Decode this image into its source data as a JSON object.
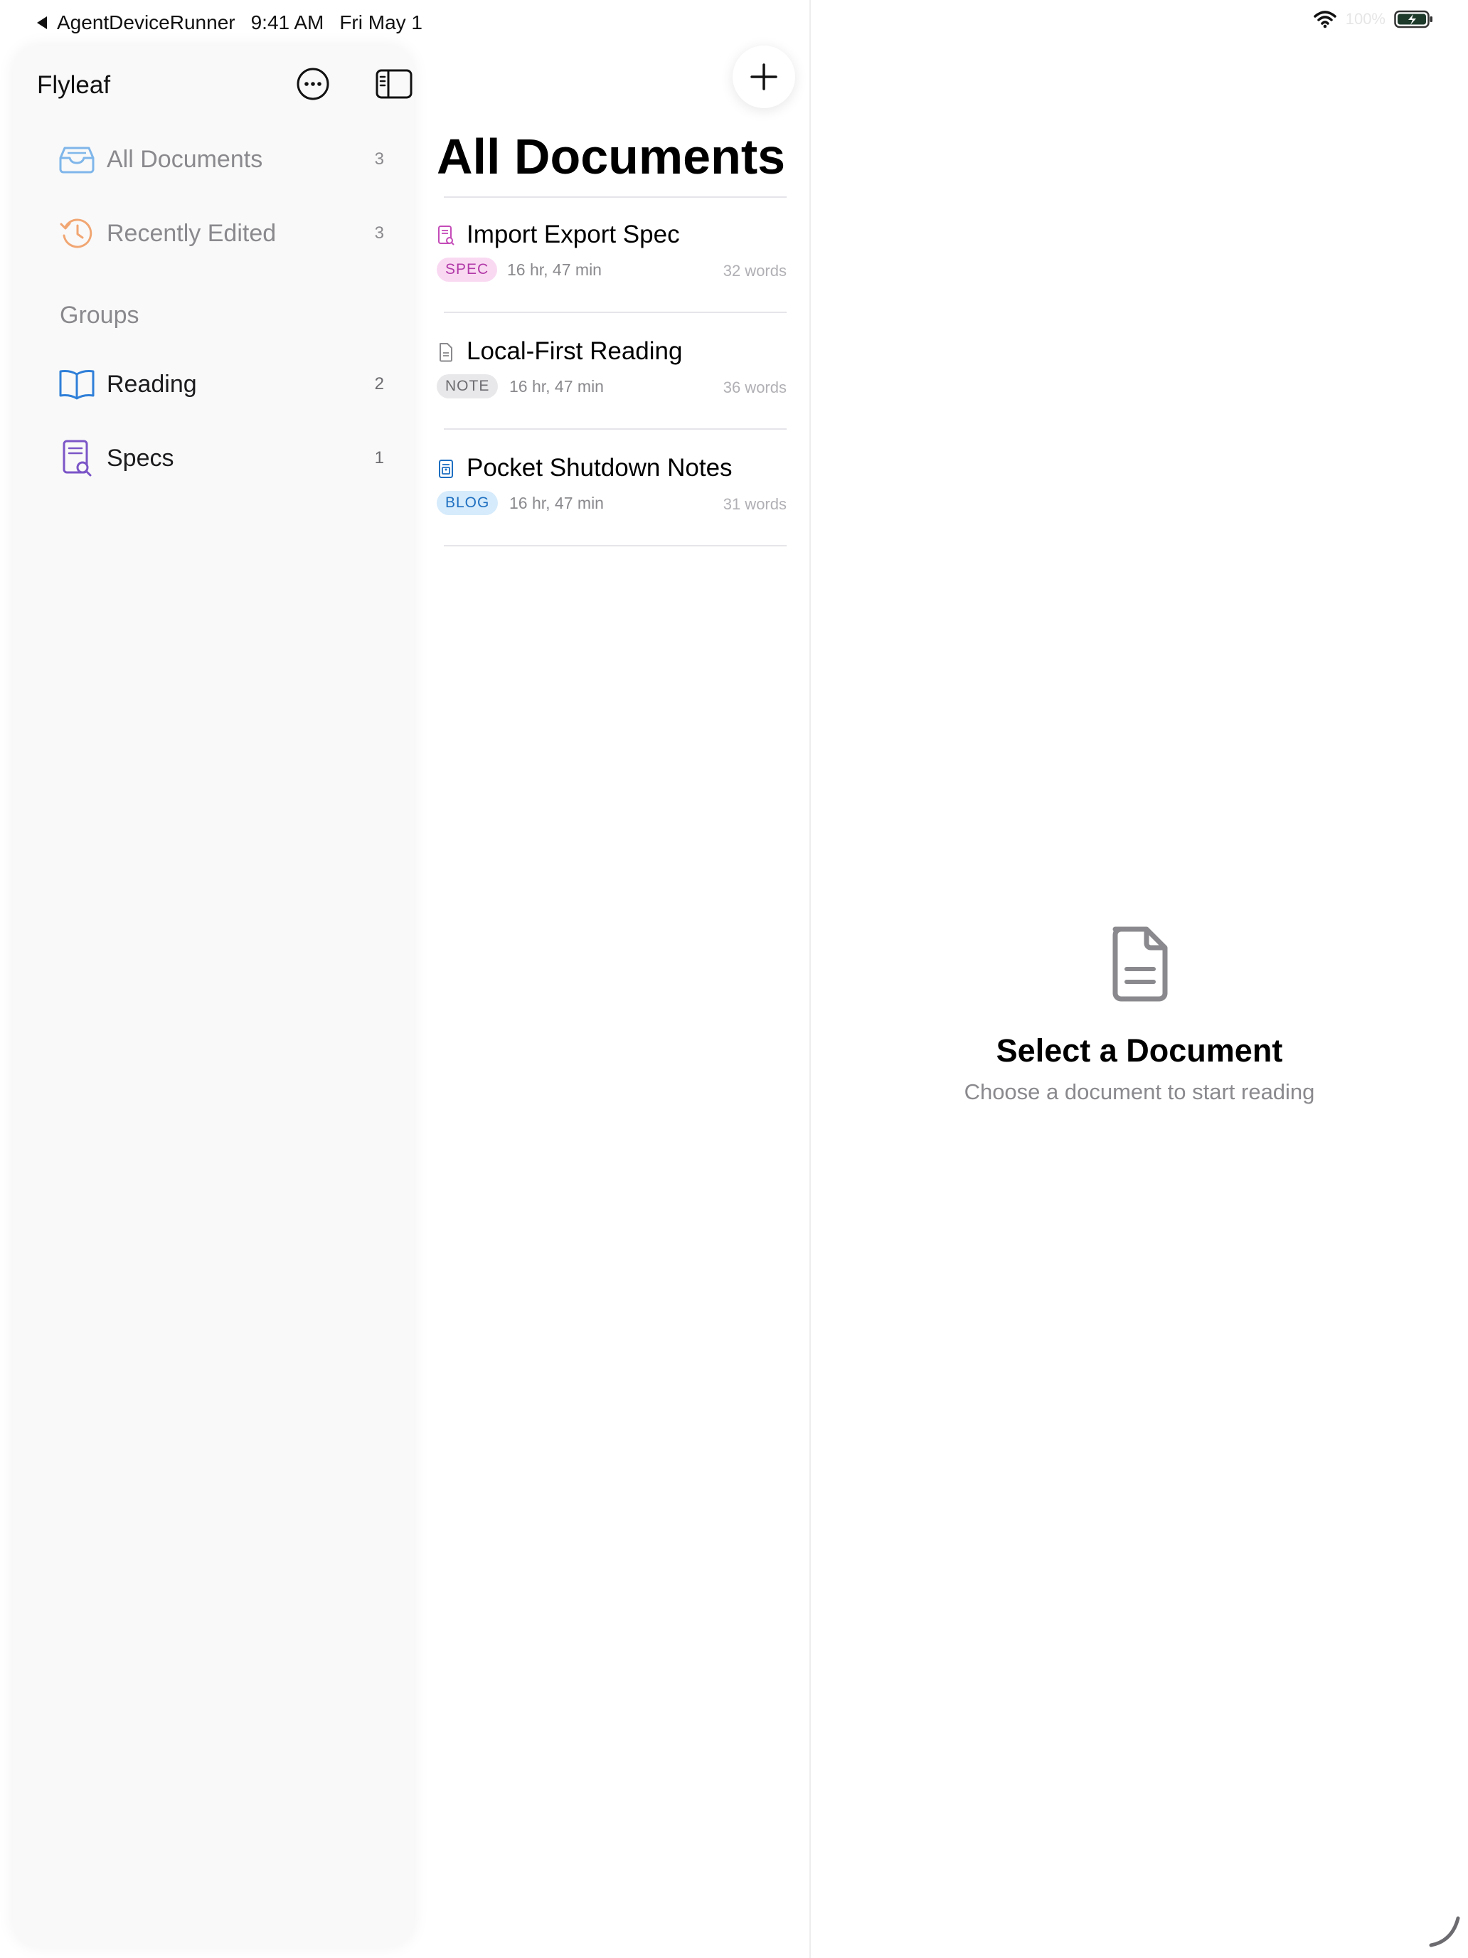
{
  "status_bar": {
    "back_app": "AgentDeviceRunner",
    "time": "9:41 AM",
    "date": "Fri May 1",
    "battery_percent": "100%"
  },
  "sidebar": {
    "app_title": "Flyleaf",
    "nav": [
      {
        "label": "All Documents",
        "count": "3",
        "icon": "tray-icon"
      },
      {
        "label": "Recently Edited",
        "count": "3",
        "icon": "history-icon"
      }
    ],
    "groups_heading": "Groups",
    "groups": [
      {
        "label": "Reading",
        "count": "2",
        "icon": "book-icon"
      },
      {
        "label": "Specs",
        "count": "1",
        "icon": "doc-search-icon"
      }
    ]
  },
  "list": {
    "title": "All Documents",
    "documents": [
      {
        "title": "Import Export Spec",
        "tag": "SPEC",
        "time": "16 hr, 47 min",
        "words": "32 words"
      },
      {
        "title": "Local-First Reading",
        "tag": "NOTE",
        "time": "16 hr, 47 min",
        "words": "36 words"
      },
      {
        "title": "Pocket Shutdown Notes",
        "tag": "BLOG",
        "time": "16 hr, 47 min",
        "words": "31 words"
      }
    ]
  },
  "detail": {
    "empty_title": "Select a Document",
    "empty_subtitle": "Choose a document to start reading"
  },
  "colors": {
    "accent_blue": "#2f7fd8",
    "spec_tag_bg": "#f9d9f2",
    "spec_tag_fg": "#b23aa8",
    "note_tag_bg": "#e8e8ea",
    "note_tag_fg": "#6c6c70",
    "blog_tag_bg": "#d6ebfb",
    "blog_tag_fg": "#1e6fc1",
    "recent_orange": "#f1a672"
  }
}
